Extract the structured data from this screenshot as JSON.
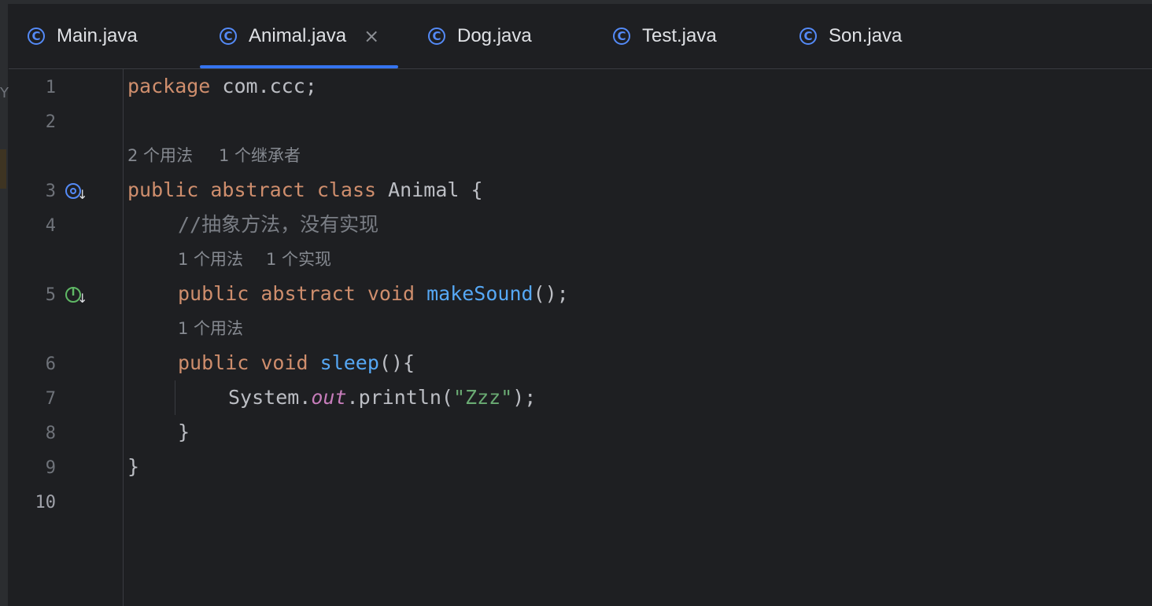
{
  "tabs": [
    {
      "label": "Main.java",
      "active": false
    },
    {
      "label": "Animal.java",
      "active": true
    },
    {
      "label": "Dog.java",
      "active": false
    },
    {
      "label": "Test.java",
      "active": false
    },
    {
      "label": "Son.java",
      "active": false
    }
  ],
  "tab_icon_letter": "C",
  "close_glyph": "×",
  "left_fragment": "Y",
  "line_numbers": [
    "1",
    "2",
    "3",
    "4",
    "5",
    "6",
    "7",
    "8",
    "9",
    "10"
  ],
  "code": {
    "l1_kw": "package",
    "l1_rest": " com.ccc;",
    "hint_class_usages": "2 个用法",
    "hint_class_inheritors": "1 个继承者",
    "l3_kw": "public abstract class",
    "l3_rest": " Animal {",
    "l4_comment": "//抽象方法，没有实现",
    "hint_make_usages": "1 个用法",
    "hint_make_impls": "1 个实现",
    "l5_kw": "public abstract void",
    "l5_fn": "makeSound",
    "l5_rest": "();",
    "hint_sleep_usages": "1 个用法",
    "l6_kw": "public void",
    "l6_fn": "sleep",
    "l6_rest": "(){",
    "l7_sys": "System.",
    "l7_out": "out",
    "l7_mid": ".println(",
    "l7_str": "\"Zzz\"",
    "l7_end": ");",
    "l8": "}",
    "l9": "}"
  },
  "gutter_icons": {
    "impl_letter": "I",
    "arrow": "↓"
  },
  "colors": {
    "background": "#1e1f22",
    "keyword": "#cf8e6d",
    "function": "#56a8f5",
    "string": "#6aab73",
    "static_field": "#c77dbb",
    "accent": "#3574f0"
  }
}
